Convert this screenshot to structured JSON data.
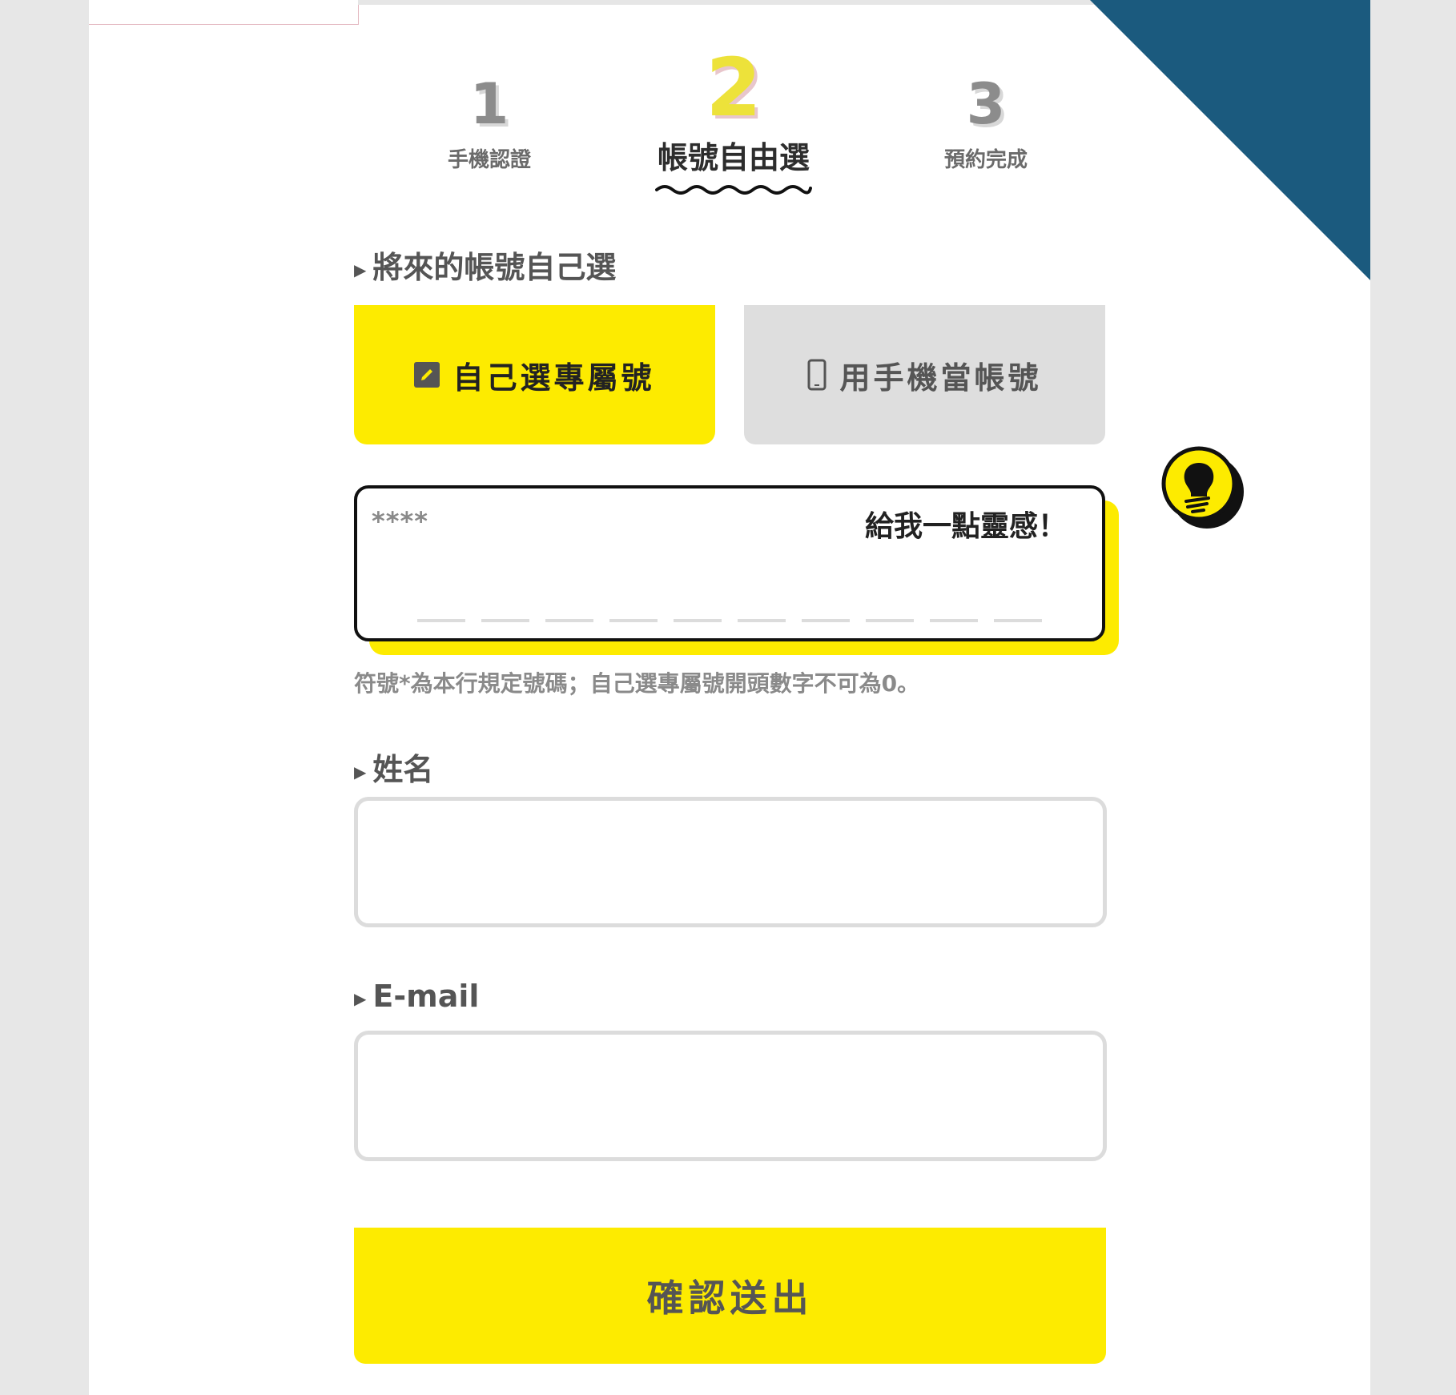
{
  "steps": [
    {
      "number": "1",
      "label": "手機認證"
    },
    {
      "number": "2",
      "label": "帳號自由選"
    },
    {
      "number": "3",
      "label": "預約完成"
    }
  ],
  "account_section": {
    "title": "將來的帳號自己選",
    "option_custom": "自己選專屬號",
    "option_phone": "用手機當帳號",
    "mask": "****",
    "inspire_label": "給我一點靈感！",
    "hint": "符號*為本行規定號碼；自己選專屬號開頭數字不可為0。"
  },
  "name_section": {
    "title": "姓名"
  },
  "email_section": {
    "title": "E-mail"
  },
  "submit_label": "確認送出",
  "colors": {
    "accent": "#fdeb00",
    "corner": "#1b5a7e",
    "inactive": "#dedede"
  },
  "icons": {
    "custom": "pencil-icon",
    "phone": "mobile-phone-icon",
    "inspire": "lightbulb-icon"
  }
}
